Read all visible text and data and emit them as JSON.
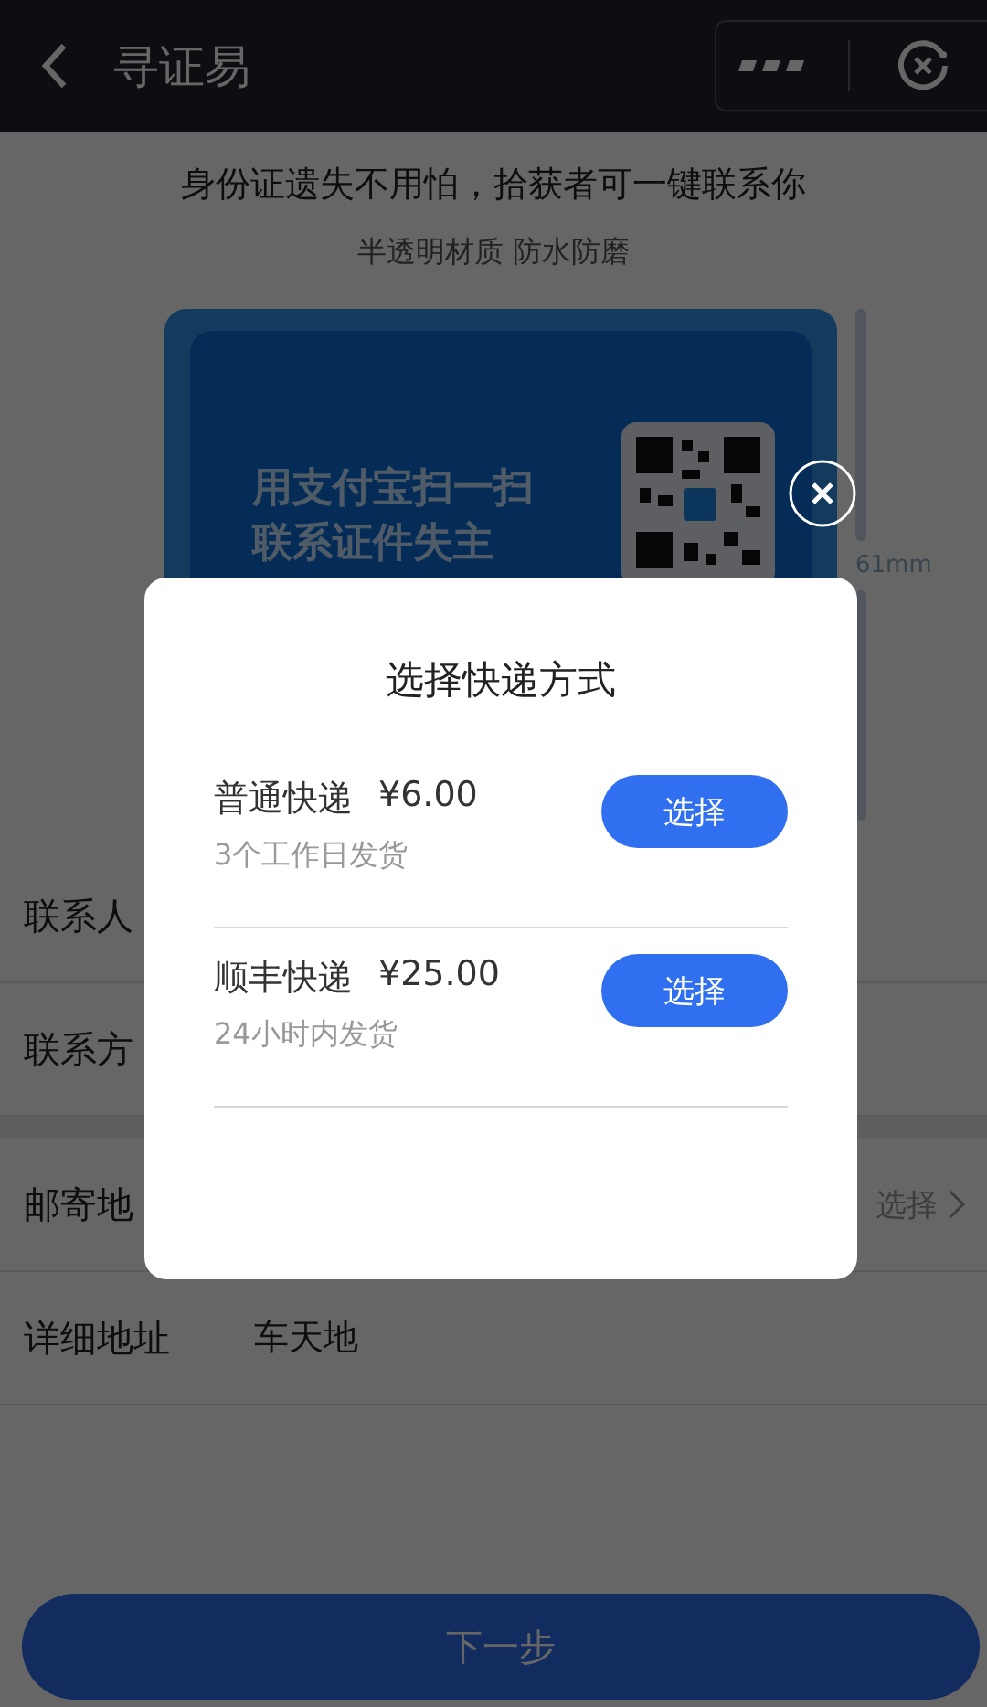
{
  "nav": {
    "title": "寻证易"
  },
  "intro": {
    "headline": "身份证遗失不用怕，拾获者可一键联系你",
    "subtitle": "半透明材质 防水防磨"
  },
  "card": {
    "lines": [
      "用支付宝扫一扫",
      "联系证件失主"
    ],
    "dimension": "61mm"
  },
  "form": {
    "sections": [
      {
        "rows": [
          {
            "label": "联系人"
          },
          {
            "label": "联系方"
          }
        ]
      },
      {
        "rows": [
          {
            "label": "邮寄地",
            "value": "选择",
            "kind": "select"
          },
          {
            "label": "详细地址",
            "value": "车天地",
            "kind": "text"
          }
        ]
      }
    ]
  },
  "next_button": "下一步",
  "dialog": {
    "title": "选择快递方式",
    "options": [
      {
        "name": "普通快递",
        "price": "¥6.00",
        "note": "3个工作日发货",
        "action": "选择"
      },
      {
        "name": "顺丰快递",
        "price": "¥25.00",
        "note": "24小时内发货",
        "action": "选择"
      }
    ]
  }
}
